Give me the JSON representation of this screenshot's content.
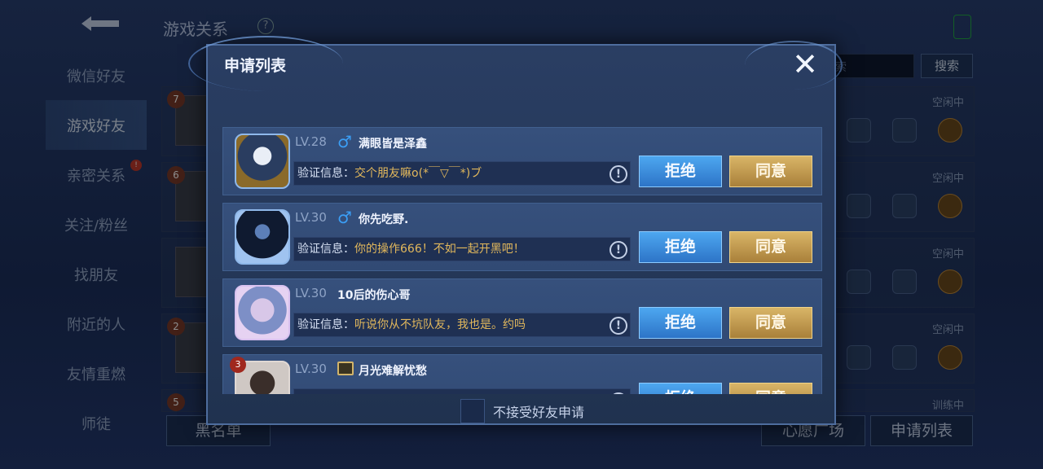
{
  "background": {
    "title": "游戏关系",
    "sidebar": [
      {
        "label": "微信好友",
        "active": false
      },
      {
        "label": "游戏好友",
        "active": true
      },
      {
        "label": "亲密关系",
        "active": false
      },
      {
        "label": "关注/粉丝",
        "active": false
      },
      {
        "label": "找朋友",
        "active": false
      },
      {
        "label": "附近的人",
        "active": false
      },
      {
        "label": "友情重燃",
        "active": false
      },
      {
        "label": "师徒",
        "active": false
      }
    ],
    "search_placeholder": "搜索",
    "search_button": "搜索",
    "rows": [
      {
        "rank": "7",
        "status": "空闲中"
      },
      {
        "rank": "6",
        "status": "空闲中"
      },
      {
        "rank": "",
        "status": "空闲中"
      },
      {
        "rank": "2",
        "status": "空闲中"
      },
      {
        "rank": "5",
        "status": "训练中"
      }
    ],
    "blacklist_button": "黑名单",
    "wish_square_button": "心愿广场",
    "apply_list_button": "申请列表"
  },
  "modal": {
    "title": "申请列表",
    "close_icon": "close-icon",
    "requests": [
      {
        "level": "LV.28",
        "gender": "male",
        "name": "满眼皆是泽鑫",
        "msg_label": "验证信息：",
        "msg_text": "交个朋友嘛o(*￣▽￣*)ブ",
        "reject": "拒绝",
        "accept": "同意"
      },
      {
        "level": "LV.30",
        "gender": "male",
        "name": "你先吃野.",
        "msg_label": "验证信息：",
        "msg_text": "你的操作666！不如一起开黑吧！",
        "reject": "拒绝",
        "accept": "同意"
      },
      {
        "level": "LV.30",
        "gender": "",
        "name": "10后的伤心哥",
        "msg_label": "验证信息：",
        "msg_text": "听说你从不坑队友，我也是。约吗",
        "reject": "拒绝",
        "accept": "同意"
      },
      {
        "level": "LV.30",
        "gender": "",
        "name": "月光难解忧愁",
        "badge": "3",
        "msg_label": "",
        "msg_text": "",
        "reject": "拒绝",
        "accept": "同意"
      }
    ],
    "footer_checkbox_label": "不接受好友申请",
    "colors": {
      "reject": "#3a8de0",
      "accept": "#c9a153",
      "male": "#3b9ef5",
      "msg_text": "#e2b85c"
    }
  }
}
